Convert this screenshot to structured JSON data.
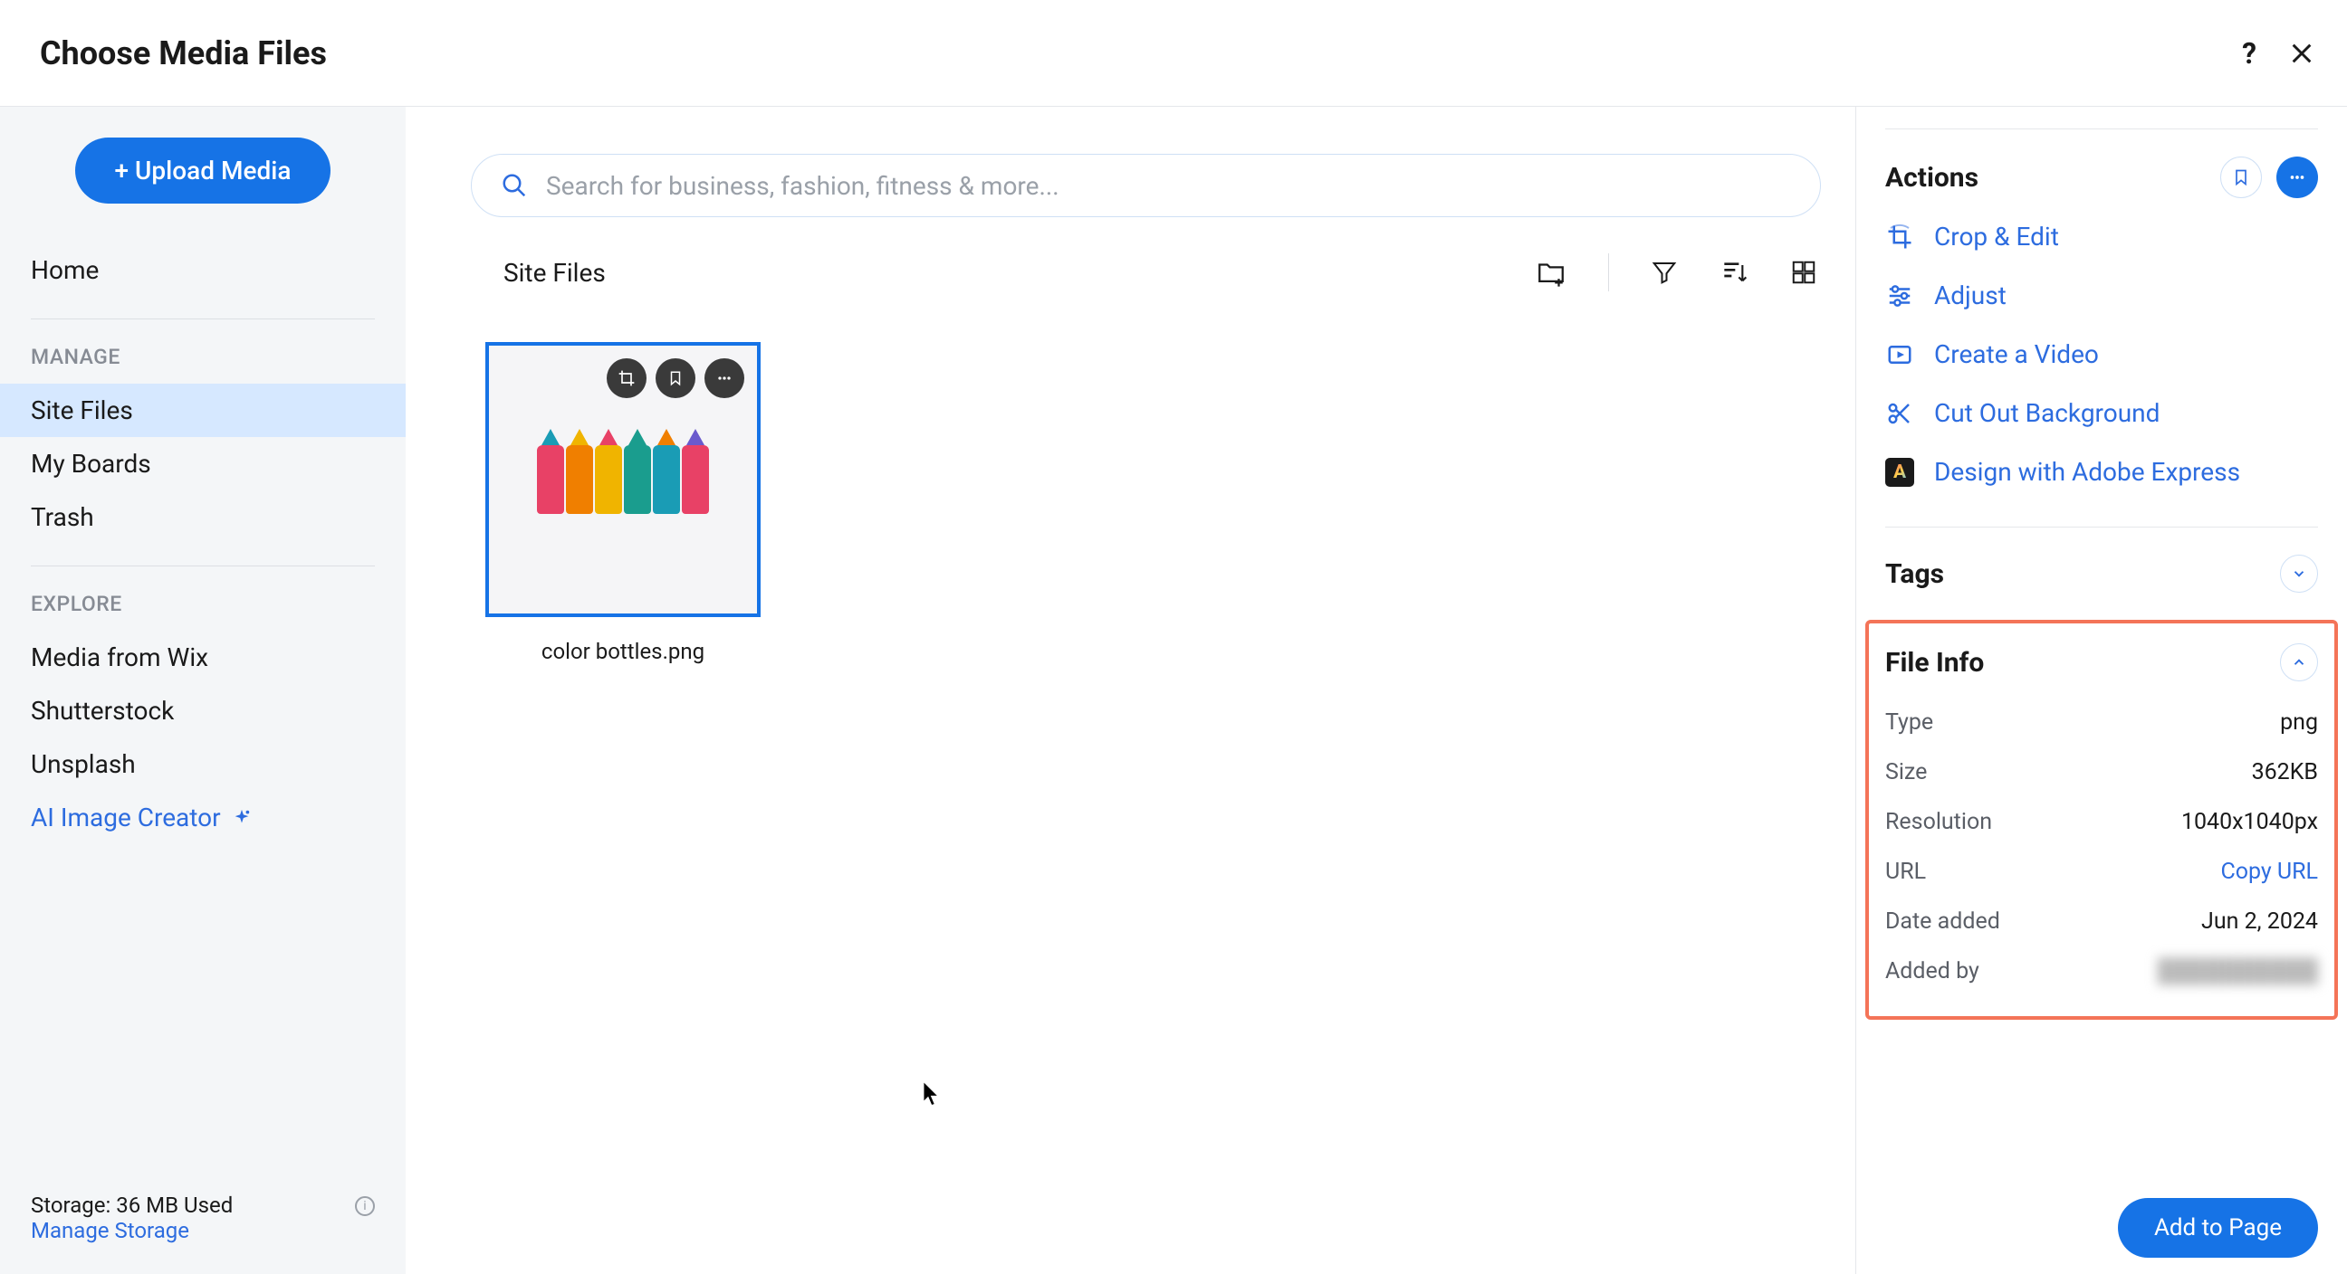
{
  "header": {
    "title": "Choose Media Files"
  },
  "sidebar": {
    "upload_label": "+ Upload Media",
    "home_label": "Home",
    "manage_heading": "MANAGE",
    "manage_items": [
      "Site Files",
      "My Boards",
      "Trash"
    ],
    "explore_heading": "EXPLORE",
    "explore_items": [
      "Media from Wix",
      "Shutterstock",
      "Unsplash"
    ],
    "ai_label": "AI Image Creator",
    "storage_label": "Storage: 36 MB Used",
    "manage_storage_label": "Manage Storage"
  },
  "search": {
    "placeholder": "Search for business, fashion, fitness & more..."
  },
  "breadcrumb": "Site Files",
  "thumbnail": {
    "filename": "color bottles.png"
  },
  "right": {
    "actions_title": "Actions",
    "actions": [
      {
        "label": "Crop & Edit",
        "icon": "crop"
      },
      {
        "label": "Adjust",
        "icon": "sliders"
      },
      {
        "label": "Create a Video",
        "icon": "video"
      },
      {
        "label": "Cut Out Background",
        "icon": "scissors"
      },
      {
        "label": "Design with Adobe Express",
        "icon": "adobe"
      }
    ],
    "tags_title": "Tags",
    "fileinfo_title": "File Info",
    "fileinfo": {
      "type_label": "Type",
      "type_val": "png",
      "size_label": "Size",
      "size_val": "362KB",
      "res_label": "Resolution",
      "res_val": "1040x1040px",
      "url_label": "URL",
      "url_val": "Copy URL",
      "date_label": "Date added",
      "date_val": "Jun 2, 2024",
      "addedby_label": "Added by",
      "addedby_val": "hidden"
    },
    "add_btn": "Add to Page"
  }
}
